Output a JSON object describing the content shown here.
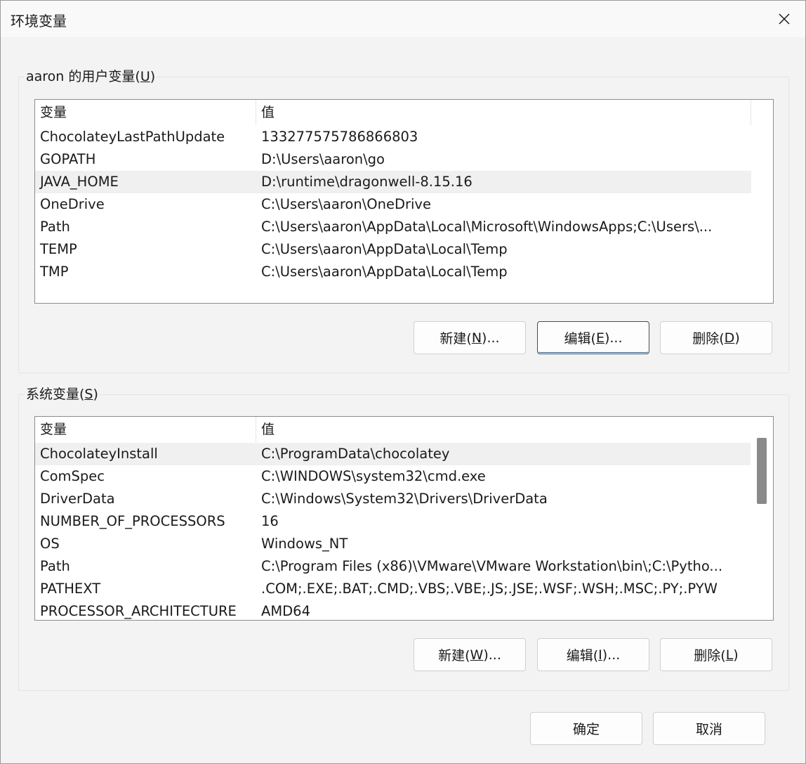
{
  "window": {
    "title": "环境变量",
    "close_glyph": "close-icon"
  },
  "user_vars": {
    "label_prefix": "aaron 的用户变量(",
    "label_key": "U",
    "label_suffix": ")",
    "columns": [
      "变量",
      "值"
    ],
    "rows": [
      {
        "name": "ChocolateyLastPathUpdate",
        "value": "133277575786866803"
      },
      {
        "name": "GOPATH",
        "value": "D:\\Users\\aaron\\go"
      },
      {
        "name": "JAVA_HOME",
        "value": "D:\\runtime\\dragonwell-8.15.16"
      },
      {
        "name": "OneDrive",
        "value": "C:\\Users\\aaron\\OneDrive"
      },
      {
        "name": "Path",
        "value": "C:\\Users\\aaron\\AppData\\Local\\Microsoft\\WindowsApps;C:\\Users\\..."
      },
      {
        "name": "TEMP",
        "value": "C:\\Users\\aaron\\AppData\\Local\\Temp"
      },
      {
        "name": "TMP",
        "value": "C:\\Users\\aaron\\AppData\\Local\\Temp"
      }
    ],
    "buttons": {
      "new": {
        "pre": "新建(",
        "key": "N",
        "post": ")..."
      },
      "edit": {
        "pre": "编辑(",
        "key": "E",
        "post": ")..."
      },
      "delete": {
        "pre": "删除(",
        "key": "D",
        "post": ")"
      }
    }
  },
  "system_vars": {
    "label_prefix": "系统变量(",
    "label_key": "S",
    "label_suffix": ")",
    "columns": [
      "变量",
      "值"
    ],
    "rows": [
      {
        "name": "ChocolateyInstall",
        "value": "C:\\ProgramData\\chocolatey"
      },
      {
        "name": "ComSpec",
        "value": "C:\\WINDOWS\\system32\\cmd.exe"
      },
      {
        "name": "DriverData",
        "value": "C:\\Windows\\System32\\Drivers\\DriverData"
      },
      {
        "name": "NUMBER_OF_PROCESSORS",
        "value": "16"
      },
      {
        "name": "OS",
        "value": "Windows_NT"
      },
      {
        "name": "Path",
        "value": "C:\\Program Files (x86)\\VMware\\VMware Workstation\\bin\\;C:\\Pytho..."
      },
      {
        "name": "PATHEXT",
        "value": ".COM;.EXE;.BAT;.CMD;.VBS;.VBE;.JS;.JSE;.WSF;.WSH;.MSC;.PY;.PYW"
      },
      {
        "name": "PROCESSOR_ARCHITECTURE",
        "value": "AMD64"
      }
    ],
    "buttons": {
      "new": {
        "pre": "新建(",
        "key": "W",
        "post": ")..."
      },
      "edit": {
        "pre": "编辑(",
        "key": "I",
        "post": ")..."
      },
      "delete": {
        "pre": "删除(",
        "key": "L",
        "post": ")"
      }
    }
  },
  "footer": {
    "ok_label": "确定",
    "cancel_label": "取消"
  },
  "colors": {
    "accent": "#0067c0",
    "highlight_row": "#f0f0f0",
    "scroll_thumb": "#8a8a8a"
  }
}
